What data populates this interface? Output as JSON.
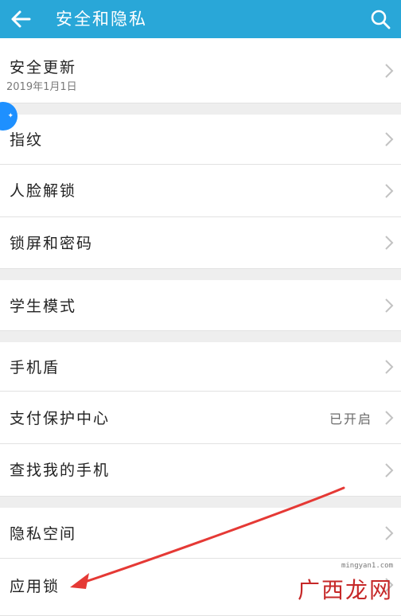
{
  "header": {
    "title": "安全和隐私",
    "background": "#29a7d8",
    "back_icon": "back-arrow-icon",
    "search_icon": "search-icon"
  },
  "items": {
    "security_update": {
      "label": "安全更新",
      "sublabel": "2019年1月1日"
    },
    "fingerprint": {
      "label": "指纹"
    },
    "face_unlock": {
      "label": "人脸解锁"
    },
    "lockscreen_password": {
      "label": "锁屏和密码"
    },
    "student_mode": {
      "label": "学生模式"
    },
    "phone_shield": {
      "label": "手机盾"
    },
    "payment_protection": {
      "label": "支付保护中心",
      "status": "已开启"
    },
    "find_my_phone": {
      "label": "查找我的手机"
    },
    "privacy_space": {
      "label": "隐私空间"
    },
    "app_lock": {
      "label": "应用锁"
    }
  },
  "watermark": {
    "domain": "mingyan1.com",
    "brand": "广西龙网"
  },
  "colors": {
    "annotation_arrow": "#e53935",
    "watermark_brand": "#c62828"
  }
}
